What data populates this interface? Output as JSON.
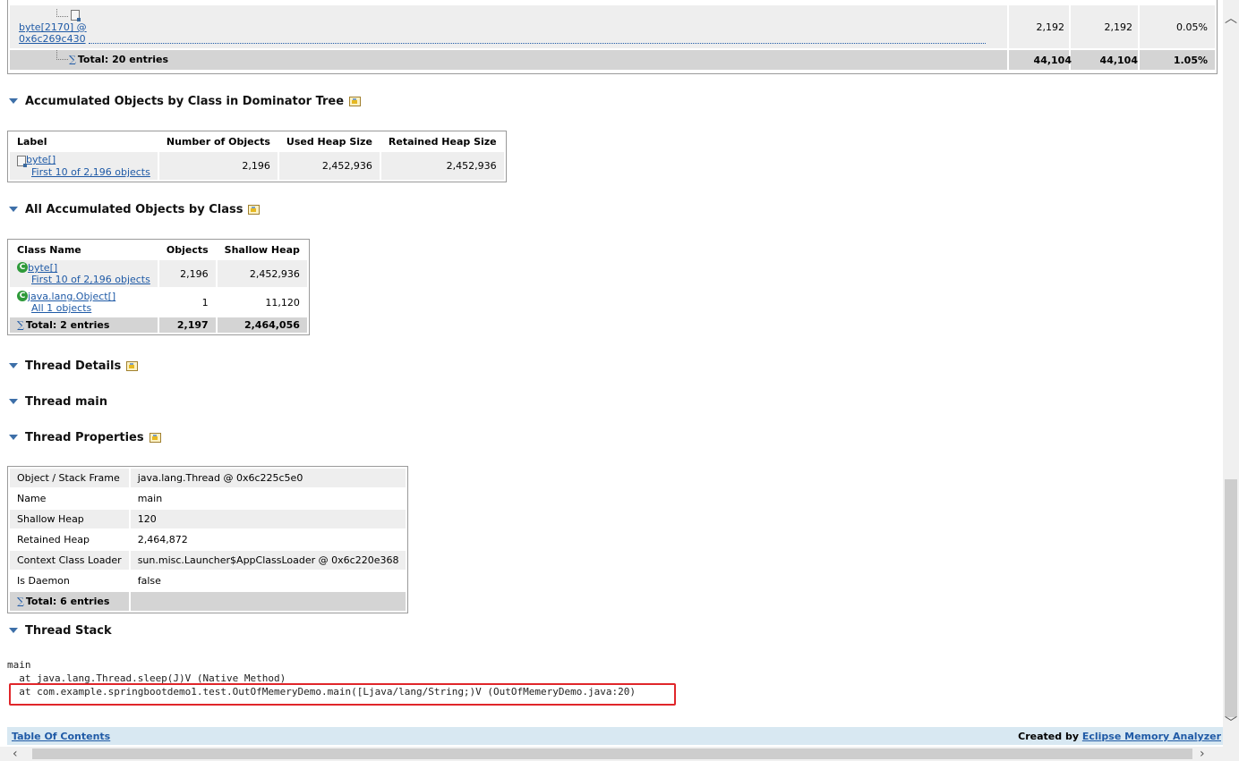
{
  "top_table": {
    "row": {
      "label_line1": "byte[2170] @",
      "label_line2": "0x6c269c430",
      "col1": "2,192",
      "col2": "2,192",
      "col3": "0.05%"
    },
    "total": {
      "label": "Total: 20 entries",
      "col1": "44,104",
      "col2": "44,104",
      "col3": "1.05%"
    }
  },
  "dominator_section": {
    "title": "Accumulated Objects by Class in Dominator Tree",
    "headers": [
      "Label",
      "Number of Objects",
      "Used Heap Size",
      "Retained Heap Size"
    ],
    "rows": [
      {
        "label": "byte[]",
        "sublink": "First 10 of 2,196 objects",
        "objects": "2,196",
        "used": "2,452,936",
        "retained": "2,452,936"
      }
    ]
  },
  "all_accumulated_section": {
    "title": "All Accumulated Objects by Class",
    "headers": [
      "Class Name",
      "Objects",
      "Shallow Heap"
    ],
    "rows": [
      {
        "label": "byte[]",
        "sublink": "First 10 of 2,196 objects",
        "objects": "2,196",
        "shallow": "2,452,936"
      },
      {
        "label": "java.lang.Object[]",
        "sublink": "All 1 objects",
        "objects": "1",
        "shallow": "11,120"
      }
    ],
    "total": {
      "label": "Total: 2 entries",
      "objects": "2,197",
      "shallow": "2,464,056"
    }
  },
  "thread_details": {
    "title": "Thread Details"
  },
  "thread_main": {
    "title": "Thread main"
  },
  "thread_properties": {
    "title": "Thread Properties",
    "rows": [
      {
        "key": "Object / Stack Frame",
        "value": "java.lang.Thread @ 0x6c225c5e0"
      },
      {
        "key": "Name",
        "value": "main"
      },
      {
        "key": "Shallow Heap",
        "value": "120"
      },
      {
        "key": "Retained Heap",
        "value": "2,464,872"
      },
      {
        "key": "Context Class Loader",
        "value": "sun.misc.Launcher$AppClassLoader @ 0x6c220e368"
      },
      {
        "key": "Is Daemon",
        "value": "false"
      }
    ],
    "total": "Total: 6 entries"
  },
  "thread_stack": {
    "title": "Thread Stack",
    "lines": [
      "main",
      "  at java.lang.Thread.sleep(J)V (Native Method)",
      "  at com.example.springbootdemo1.test.OutOfMemeryDemo.main([Ljava/lang/String;)V (OutOfMemeryDemo.java:20)"
    ]
  },
  "footer": {
    "toc_link": "Table Of Contents",
    "created_by": "Created by",
    "mat_link": "Eclipse Memory Analyzer"
  },
  "icons": {
    "section_toggle": "collapse-triangle-icon",
    "details": "details-icon",
    "object": "object-icon",
    "class": "class-icon",
    "total": "sigma-icon"
  }
}
